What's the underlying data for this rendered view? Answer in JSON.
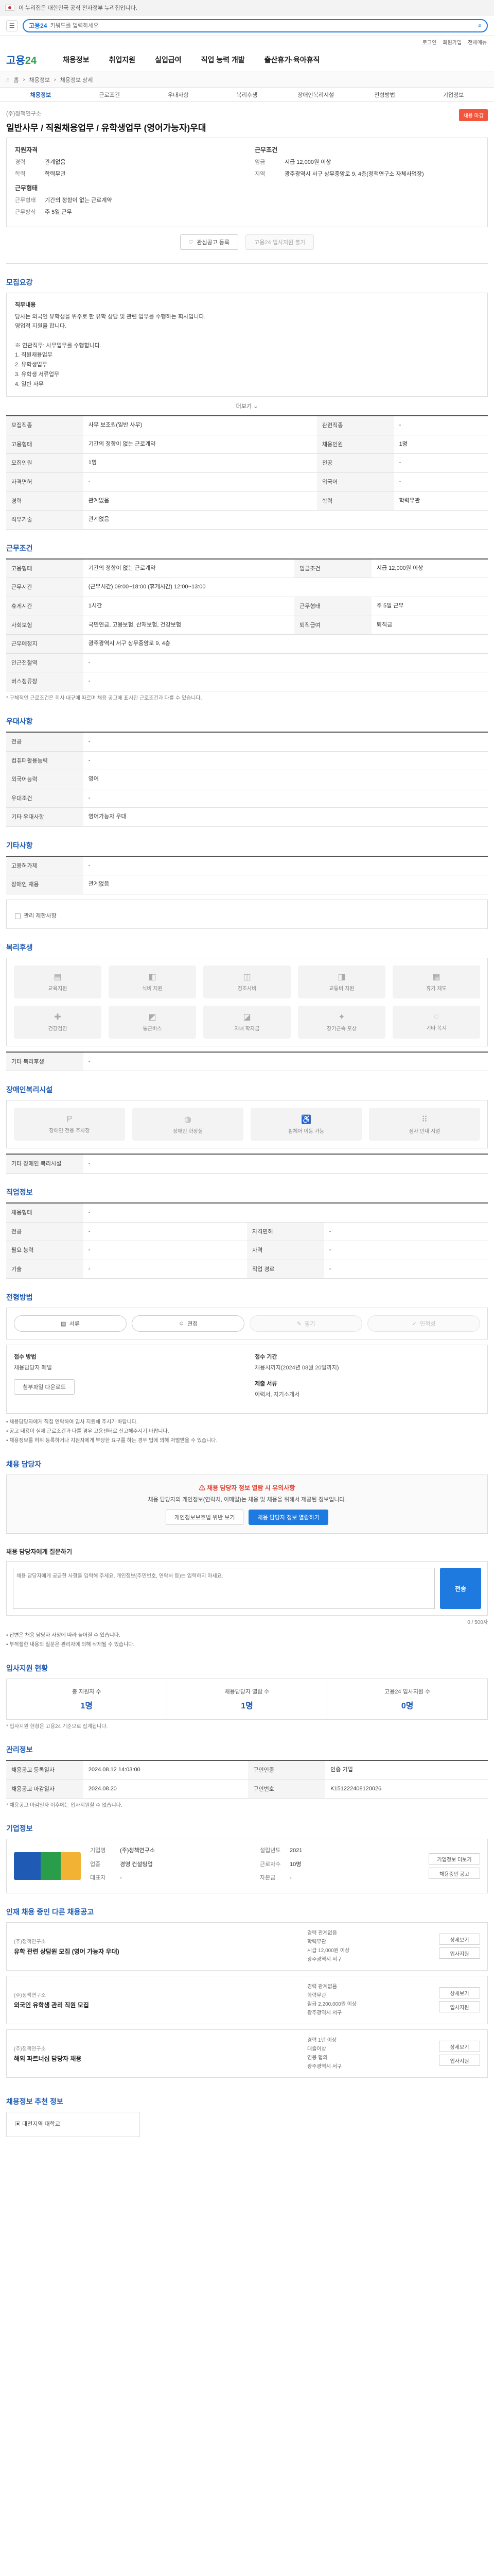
{
  "topbar": {
    "gov_text": "이 누리집은 대한민국 공식 전자정부 누리집입니다."
  },
  "search": {
    "placeholder": "키워드를 입력하세요",
    "label": "고용24"
  },
  "util": [
    "로그인",
    "회원가입",
    "전체메뉴"
  ],
  "header": {
    "logo_a": "고용",
    "logo_b": "24",
    "menu": [
      "채용정보",
      "취업지원",
      "실업급여",
      "직업 능력 개발",
      "출산휴가·육아휴직"
    ]
  },
  "breadcrumb": [
    "홈",
    "채용정보",
    "채용정보 상세"
  ],
  "subtabs": [
    "채용정보",
    "근로조건",
    "우대사항",
    "복리후생",
    "장애인복리시설",
    "전형방법",
    "기업정보"
  ],
  "title": {
    "company": "(주)정책연구소",
    "job": "일반사무 / 직원채용업무 / 유학생업무 (영어가능자)우대",
    "badge": "채용 마감"
  },
  "summary": {
    "left_head1": "지원자격",
    "left1": [
      [
        "경력",
        "관계없음"
      ],
      [
        "학력",
        "학력무관"
      ]
    ],
    "left_head2": "근무형태",
    "left2": [
      [
        "근무형태",
        "기간의 정함이 없는 근로계약"
      ],
      [
        "근무방식",
        "주 5일 근무"
      ]
    ],
    "right_head1": "근무조건",
    "right1": [
      [
        "임금",
        "시급 12,000원 이상"
      ],
      [
        "지역",
        "광주광역시 서구 상무중앙로 9, 4층(정책연구소 자체사업장)"
      ]
    ]
  },
  "actions": {
    "interest": "관심공고 등록",
    "apply": "고용24 입사지원 불가"
  },
  "recruit": {
    "title": "모집요강",
    "subhead": "직무내용",
    "body": [
      "당사는 외국인 유학생을 위주로 한 유학 상담 및 관련 업무를 수행하는 회사입니다.",
      "영업적 지원을 합니다.",
      "",
      "※ 연관직무: 사무업무를 수행합니다.",
      "1. 직원채용업무",
      "2. 유학생업무",
      "3. 유학생 서류업무",
      "4. 일반 사무"
    ],
    "more": "더보기"
  },
  "recruit_table": [
    [
      "모집직종",
      "사무 보조원(일반 사무)",
      "관련직종",
      "-"
    ],
    [
      "고용형태",
      "기간의 정함이 없는 근로계약",
      "채용인원",
      "1명"
    ],
    [
      "모집인원",
      "1명",
      "전공",
      "-"
    ],
    [
      "자격면허",
      "-",
      "외국어",
      "-"
    ],
    [
      "경력",
      "관계없음",
      "학력",
      "학력무관"
    ],
    [
      "직무기술",
      "관계없음",
      "",
      ""
    ]
  ],
  "work": {
    "title": "근무조건",
    "rows": [
      [
        "고용형태",
        "기간의 정함이 없는 근로계약",
        "임금조건",
        "시급 12,000원 이상"
      ],
      [
        "근무시간",
        "(근무시간) 09:00~18:00 (휴게시간) 12:00~13:00",
        "",
        ""
      ],
      [
        "휴게시간",
        "1시간",
        "근무형태",
        "주 5일 근무"
      ],
      [
        "사회보험",
        "국민연금, 고용보험, 산재보험, 건강보험",
        "퇴직급여",
        "퇴직금"
      ],
      [
        "근무예정지",
        "광주광역시 서구 상무중앙로 9, 4층",
        "",
        ""
      ],
      [
        "인근전철역",
        "-",
        "",
        ""
      ],
      [
        "버스정류장",
        "-",
        "",
        ""
      ]
    ],
    "note": "* 구체적인 근로조건은 회사 내규에 따르며 채용 공고에 표시된 근로조건과 다를 수 있습니다."
  },
  "prefer": {
    "title": "우대사항",
    "rows": [
      [
        "전공",
        "-"
      ],
      [
        "컴퓨터활용능력",
        "-"
      ],
      [
        "외국어능력",
        "영어"
      ],
      [
        "우대조건",
        "-"
      ],
      [
        "기타 우대사항",
        "영어가능자 우대"
      ]
    ]
  },
  "etc": {
    "title": "기타사항",
    "rows": [
      [
        "고용허가제",
        "-"
      ],
      [
        "장애인 채용",
        "관계없음"
      ]
    ],
    "ack": "관리 제한사항"
  },
  "welfare": {
    "title": "복리후생",
    "items": [
      "교육지원",
      "식비 지원",
      "경조사비",
      "교통비 지원",
      "휴가 제도",
      "건강검진",
      "통근버스",
      "자녀 학자금",
      "장기근속 포상",
      "기타 복지"
    ],
    "etc_label": "기타 복리후생",
    "etc_value": "-"
  },
  "facility": {
    "title": "장애인복리시설",
    "items": [
      "장애인 전용 주차장",
      "장애인 화장실",
      "휠체어 이동 가능",
      "점자 안내 시설"
    ],
    "etc_label": "기타 장애인 복리시설",
    "etc_value": "-"
  },
  "jobs_info": {
    "title": "직업정보",
    "rows": [
      [
        "채용형태",
        "-",
        "",
        ""
      ],
      [
        "전공",
        "-",
        "자격면허",
        "-"
      ],
      [
        "필요 능력",
        "-",
        "자격",
        "-"
      ],
      [
        "기술",
        "-",
        "직업 경로",
        "-"
      ]
    ]
  },
  "selection": {
    "title": "전형방법",
    "steps": [
      "서류",
      "면접",
      "필기",
      "인적성"
    ]
  },
  "apply": {
    "doc_label": "접수 방법",
    "doc_value": "채용담당자 메일",
    "period_label": "접수 기간",
    "period_value": "채용시까지(2024년 08월 20일까지)",
    "submit_label": "제출 서류",
    "submit_value": "이력서, 자기소개서",
    "download": "첨부파일 다운로드",
    "bullets": [
      "• 채용담당자에게 직접 연락하여 입사 지원해 주시기 바랍니다.",
      "• 공고 내용이 실제 근로조건과 다를 경우 고용센터로 신고해주시기 바랍니다.",
      "• 채용정보를 허위 등록하거나 지원자에게 부당한 요구를 하는 경우 법에 의해 처벌받을 수 있습니다."
    ]
  },
  "contact": {
    "title": "채용 담당자",
    "head": "채용 담당자 정보 열람 시 유의사항",
    "desc": "채용 담당자의 개인정보(연락처, 이메일)는 채용 및 채용을 위해서 제공된 정보입니다.",
    "btn1": "개인정보보호법 위반 보기",
    "btn2": "채용 담당자 정보 열람하기"
  },
  "inquiry": {
    "title": "채용 담당자에게 질문하기",
    "placeholder": "채용 담당자에게 궁금한 사항을 입력해 주세요. 개인정보(주민번호, 연락처 등)는 입력하지 마세요.",
    "counter": "0 / 500자",
    "send": "전송",
    "notes": [
      "• 답변은 채용 담당자 사정에 따라 늦어질 수 있습니다.",
      "• 부적절한 내용의 질문은 관리자에 의해 삭제될 수 있습니다."
    ]
  },
  "stats": {
    "title": "입사지원 현황",
    "items": [
      [
        "총 지원자 수",
        "1명"
      ],
      [
        "채용담당자 열람 수",
        "1명"
      ],
      [
        "고용24 입사지원 수",
        "0명"
      ]
    ],
    "note": "* 입사지원 현황은 고용24 기준으로 집계됩니다."
  },
  "manage": {
    "title": "관리정보",
    "rows": [
      [
        "채용공고 등록일자",
        "2024.08.12 14:03:00",
        "구인인증",
        "인증 기업"
      ],
      [
        "채용공고 마감일자",
        "2024.08.20",
        "구인번호",
        "K151222408120026"
      ]
    ],
    "note": "* 채용공고 마감일자 이후에는 입사지원할 수 없습니다."
  },
  "company": {
    "title": "기업정보",
    "name": "(주)정책연구소",
    "rows": [
      [
        "기업명",
        "(주)정책연구소"
      ],
      [
        "업종",
        "경영 컨설팅업"
      ],
      [
        "대표자",
        "-"
      ],
      [
        "설립년도",
        "2021"
      ],
      [
        "근로자수",
        "10명"
      ],
      [
        "자본금",
        "-"
      ]
    ],
    "btn1": "기업정보 더보기",
    "btn2": "채용중인 공고"
  },
  "others": {
    "title": "인재 채용 중인 다른 채용공고",
    "items": [
      {
        "company": "(주)정책연구소",
        "title": "유학 관련 상담원 모집 (영어 가능자 우대)",
        "details": [
          "경력 관계없음",
          "학력무관",
          "시급 12,000원 이상",
          "광주광역시 서구"
        ]
      },
      {
        "company": "(주)정책연구소",
        "title": "외국인 유학생 관리 직원 모집",
        "details": [
          "경력 관계없음",
          "학력무관",
          "월급 2,200,000원 이상",
          "광주광역시 서구"
        ]
      },
      {
        "company": "(주)정책연구소",
        "title": "해외 파트너십 담당자 채용",
        "details": [
          "경력 1년 이상",
          "대졸이상",
          "연봉 협의",
          "광주광역시 서구"
        ]
      }
    ],
    "btn_detail": "상세보기",
    "btn_apply": "입사지원"
  },
  "recommend": {
    "title": "채용정보 추천 정보",
    "label": "대전지역 대학교"
  }
}
